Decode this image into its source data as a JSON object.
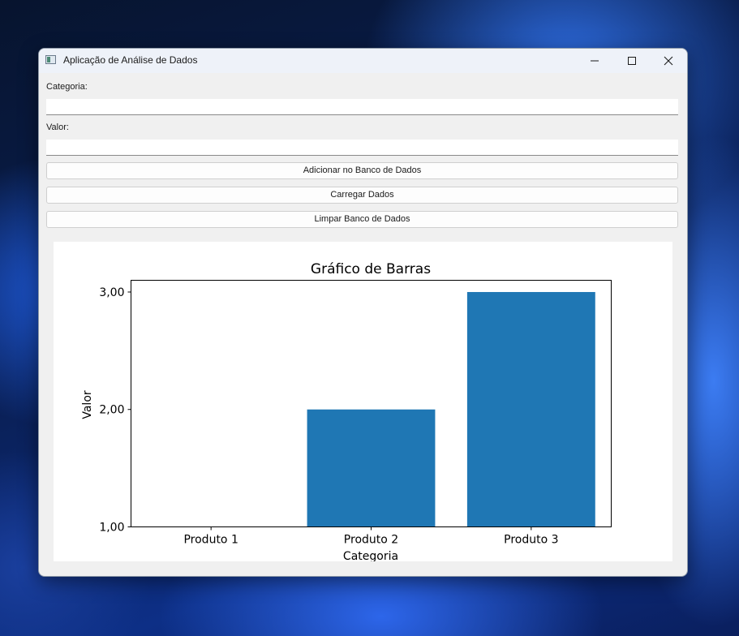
{
  "window": {
    "title": "Aplicação de Análise de Dados"
  },
  "form": {
    "category_label": "Categoria:",
    "category_value": "",
    "value_label": "Valor:",
    "value_value": ""
  },
  "buttons": {
    "add": "Adicionar no Banco de Dados",
    "load": "Carregar Dados",
    "clear": "Limpar Banco de Dados"
  },
  "chart_data": {
    "type": "bar",
    "title": "Gráfico de Barras",
    "xlabel": "Categoria",
    "ylabel": "Valor",
    "categories": [
      "Produto 1",
      "Produto 2",
      "Produto 3"
    ],
    "values": [
      1,
      2,
      3
    ],
    "ylim": [
      1,
      3.1
    ],
    "yticks": [
      1,
      2,
      3
    ],
    "ytick_labels": [
      "1,00",
      "2,00",
      "3,00"
    ],
    "bar_color": "#1f77b4",
    "grid": false
  }
}
